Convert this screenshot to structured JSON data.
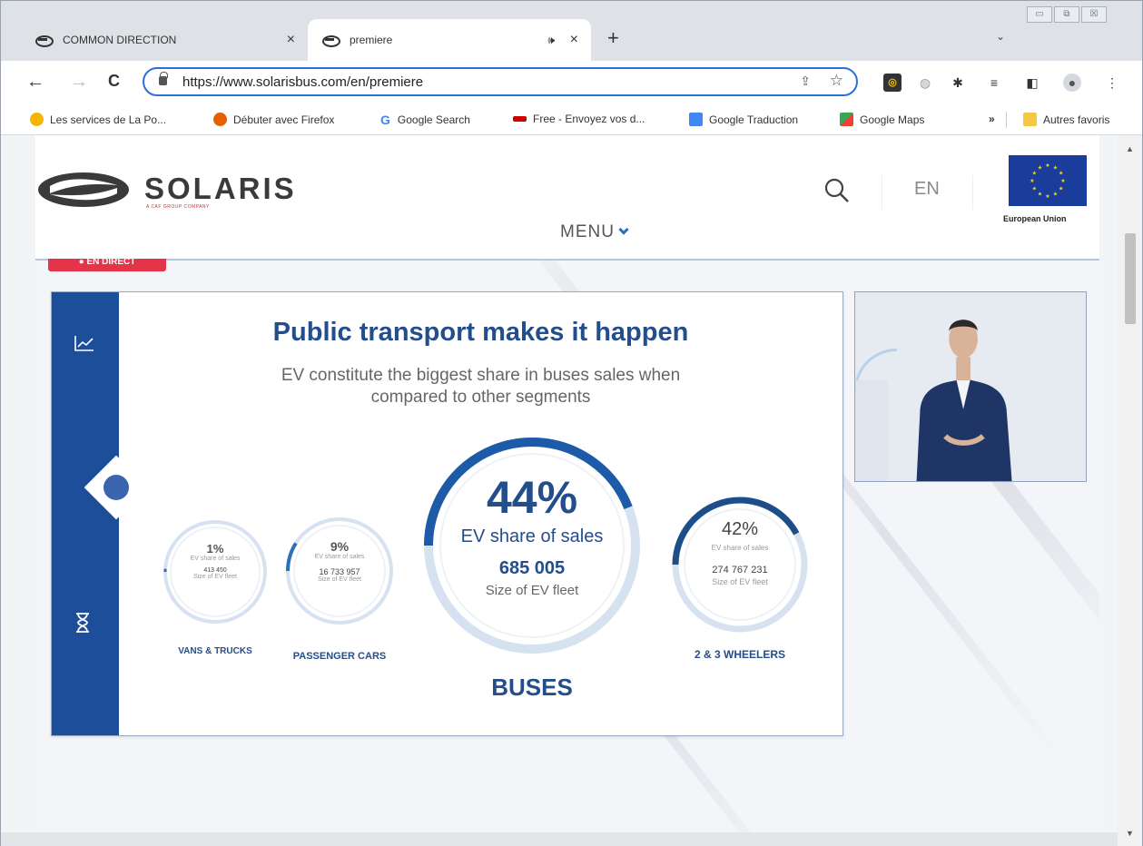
{
  "browser": {
    "tabs": [
      {
        "title": "COMMON DIRECTION",
        "close": "×"
      },
      {
        "title": "premiere",
        "close": "×",
        "audio": "🕪"
      }
    ],
    "new_tab": "+",
    "tab_menu": "⌄",
    "window_controls": [
      "▭",
      "⧉",
      "☒"
    ],
    "nav": {
      "back": "←",
      "forward": "→",
      "reload": "C"
    },
    "url": "https://www.solarisbus.com/en/premiere",
    "toolbar_icons": [
      "extension-icon",
      "shield-icon",
      "puzzle-icon",
      "reading-list-icon",
      "side-panel-icon",
      "profile-icon",
      "menu-icon"
    ],
    "bookmarks": [
      {
        "label": "Les services de La Po...",
        "color": "#f4b400"
      },
      {
        "label": "Débuter avec Firefox",
        "color": "#e66000"
      },
      {
        "label": "Google Search",
        "color": "#4285f4"
      },
      {
        "label": "Free - Envoyez vos d...",
        "color": "#cc0000"
      },
      {
        "label": "Google Traduction",
        "color": "#4285f4"
      },
      {
        "label": "Google Maps",
        "color": "#34a853"
      }
    ],
    "bookmarks_overflow": "»",
    "other_bookmarks": "Autres favoris"
  },
  "site": {
    "logo": "SOLARIS",
    "logo_sub": "A CAF GROUP COMPANY",
    "language": "EN",
    "eu_label": "European Union",
    "menu": "MENU",
    "live_badge": "● EN DIRECT"
  },
  "slide": {
    "title": "Public transport makes it happen",
    "subtitle": "EV constitute the biggest share in buses sales when compared to other segments",
    "segments": [
      {
        "key": "vans",
        "category": "VANS & TRUCKS",
        "share": "1%",
        "share_label": "EV share of sales",
        "fleet": "413 450",
        "fleet_label": "Size of EV fleet",
        "fraction": 0.01
      },
      {
        "key": "cars",
        "category": "PASSENGER CARS",
        "share": "9%",
        "share_label": "EV share of sales",
        "fleet": "16 733 957",
        "fleet_label": "Size of EV fleet",
        "fraction": 0.09
      },
      {
        "key": "buses",
        "category": "BUSES",
        "share": "44%",
        "share_label": "EV share of sales",
        "fleet": "685 005",
        "fleet_label": "Size of EV fleet",
        "fraction": 0.44
      },
      {
        "key": "wheelers",
        "category": "2 & 3 WHEELERS",
        "share": "42%",
        "share_label": "EV share of sales",
        "fleet": "274 767 231",
        "fleet_label": "Size of EV fleet",
        "fraction": 0.42
      }
    ]
  },
  "colors": {
    "brand_blue": "#234d8b",
    "rail_blue": "#1d4e9a",
    "ring_track": "#d6e2f0",
    "live_red": "#e3344a"
  }
}
